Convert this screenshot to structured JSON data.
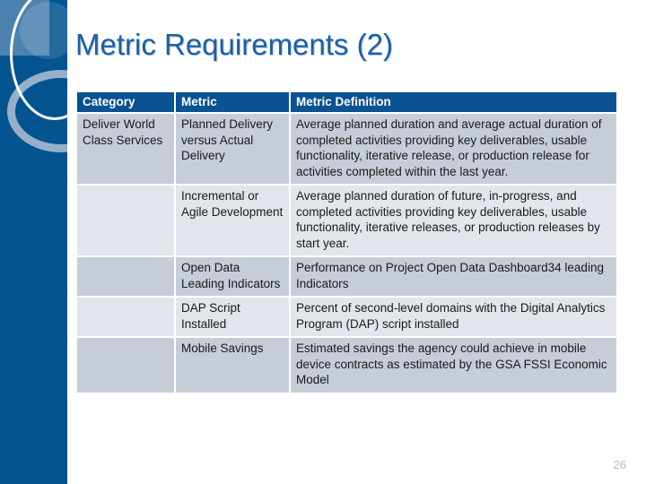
{
  "slide": {
    "title": "Metric Requirements (2)",
    "page_number": "26",
    "accent_blue": "#03548f",
    "header_blue": "#0a5291",
    "title_color": "#1b5fa8",
    "row_dark": "#c7cdd8",
    "row_light": "#e3e5ec"
  },
  "table": {
    "headers": [
      "Category",
      "Metric",
      "Metric Definition"
    ],
    "rows": [
      {
        "category": "Deliver World Class Services",
        "metric": "Planned Delivery versus Actual Delivery",
        "definition": "Average planned duration and average actual duration of completed activities providing key deliverables, usable functionality, iterative release, or production release for activities completed within the last year."
      },
      {
        "category": "",
        "metric": "Incremental or Agile Development",
        "definition": "Average planned duration of future, in-progress, and completed activities providing key deliverables, usable functionality, iterative releases, or production releases by start year."
      },
      {
        "category": "",
        "metric": "Open Data Leading Indicators",
        "definition": "Performance on Project Open Data Dashboard34 leading Indicators"
      },
      {
        "category": "",
        "metric": "DAP Script Installed",
        "definition": "Percent of second-level domains with the Digital Analytics Program (DAP) script installed"
      },
      {
        "category": "",
        "metric": "Mobile Savings",
        "definition": "Estimated savings the agency could achieve in mobile device contracts as estimated by the GSA FSSI Economic Model"
      }
    ]
  }
}
